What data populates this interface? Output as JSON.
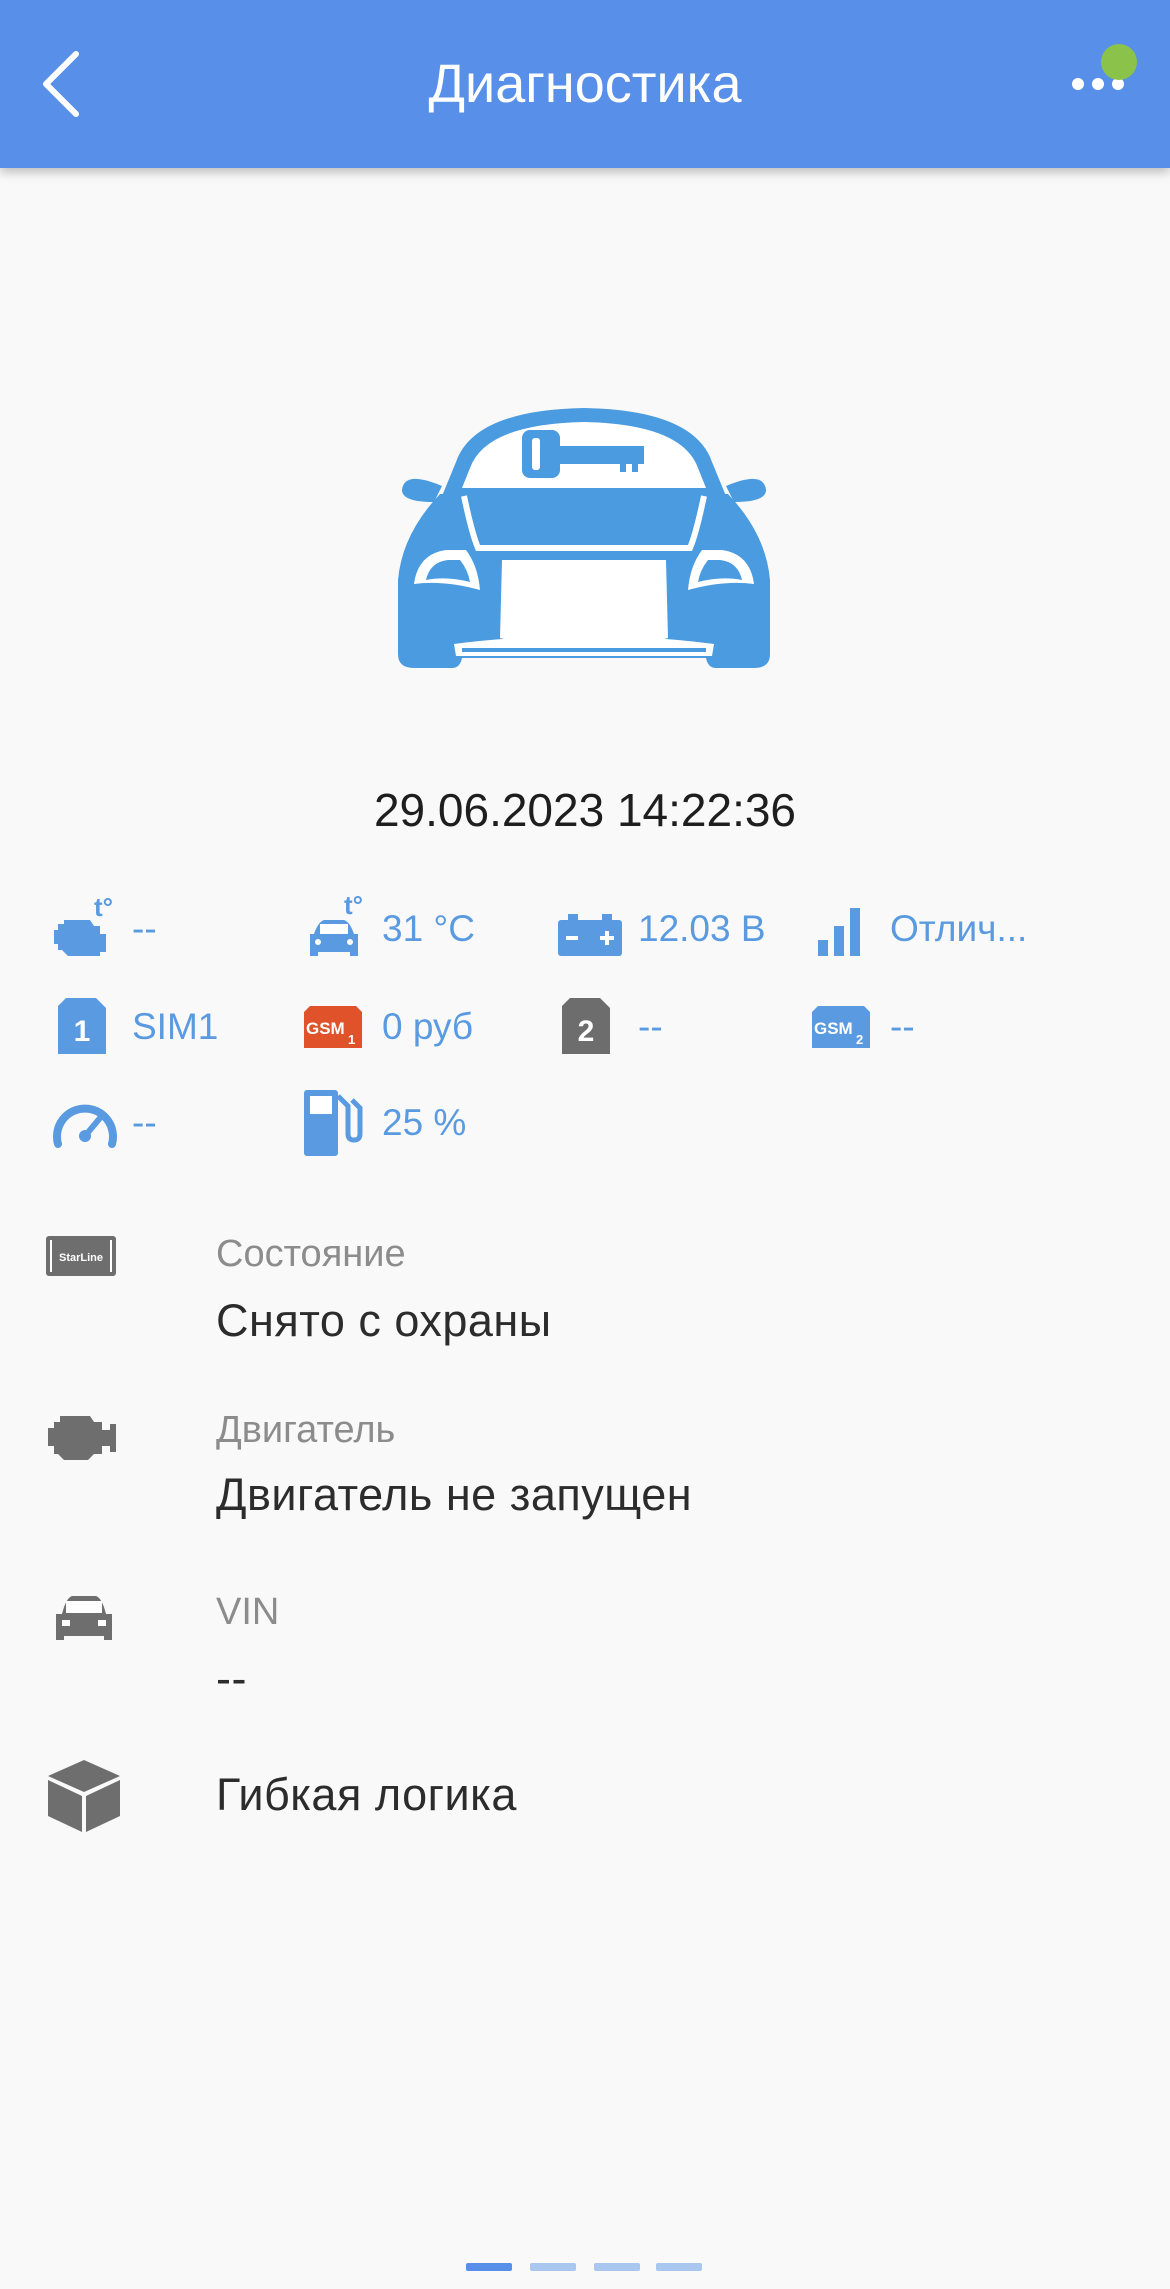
{
  "header": {
    "title": "Диагностика"
  },
  "datetime": "29.06.2023  14:22:36",
  "stats": [
    {
      "icon": "engine-temp-icon",
      "value": "--"
    },
    {
      "icon": "cabin-temp-icon",
      "value": "31 °C"
    },
    {
      "icon": "battery-icon",
      "value": "12.03 В"
    },
    {
      "icon": "signal-icon",
      "value": "Отлич..."
    },
    {
      "icon": "sim1-icon",
      "value": "SIM1"
    },
    {
      "icon": "gsm1-balance-icon",
      "value": "0 руб"
    },
    {
      "icon": "sim2-icon",
      "value": "--"
    },
    {
      "icon": "gsm2-balance-icon",
      "value": "--"
    },
    {
      "icon": "speedometer-icon",
      "value": "--"
    },
    {
      "icon": "fuel-icon",
      "value": "25 %"
    }
  ],
  "icon_text": {
    "engine_t": "t°",
    "cabin_t": "t°",
    "sim1": "1",
    "sim2": "2",
    "gsm1": "GSM",
    "gsm1_sub": "1",
    "gsm2": "GSM",
    "gsm2_sub": "2",
    "starline": "StarLine"
  },
  "info": {
    "state": {
      "label": "Состояние",
      "value": "Снято с охраны"
    },
    "engine": {
      "label": "Двигатель",
      "value": "Двигатель не запущен"
    },
    "vin": {
      "label": "VIN",
      "value": "--"
    },
    "logic": {
      "label": "Гибкая логика"
    }
  },
  "colors": {
    "header": "#588fe8",
    "accent": "#5a9ae0",
    "car": "#4a9be0",
    "status_online": "#8bc34a",
    "gsm1": "#e0532a",
    "sim2": "#6d6d6d",
    "icon_gray": "#6e6e6e"
  },
  "pager": {
    "pages": 4,
    "active": 1
  }
}
